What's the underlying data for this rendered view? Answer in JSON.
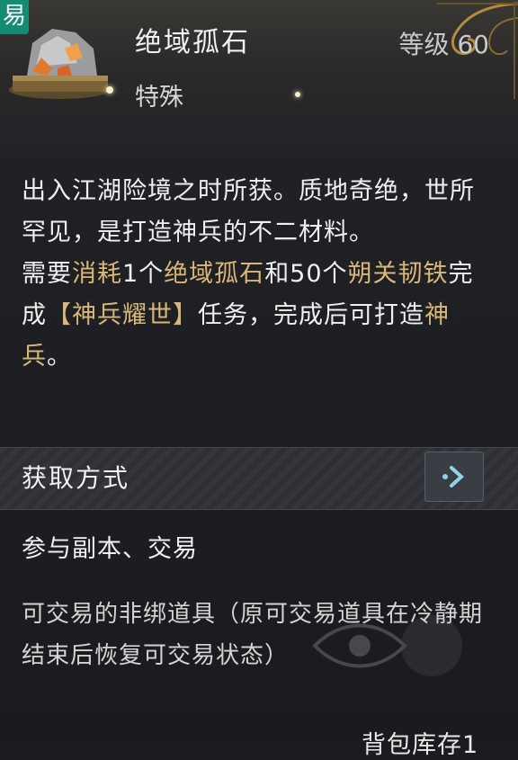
{
  "item": {
    "badge": "易",
    "name": "绝域孤石",
    "level": "等级 60",
    "category": "特殊"
  },
  "description": {
    "line1": "出入江湖险境之时所获。质地奇绝，世所罕见，是打造神兵的不二材料。",
    "req_prefix": "需要",
    "req_consume": "消耗",
    "req_qty1": "1个",
    "req_item1": "绝域孤石",
    "req_and": "和50个",
    "req_item2": "朔关韧铁",
    "req_complete": "完成",
    "req_quest": "【神兵耀世】",
    "req_suffix": "任务，完成后可打造",
    "req_result": "神兵",
    "req_end": "。"
  },
  "acquire": {
    "title": "获取方式",
    "sources": "参与副本、交易"
  },
  "trade_note": "可交易的非绑道具（原可交易道具在冷静期结束后恢复可交易状态）",
  "bag_stock": "背包库存1",
  "colors": {
    "highlight": "#d9b777",
    "badge": "#138c73"
  }
}
